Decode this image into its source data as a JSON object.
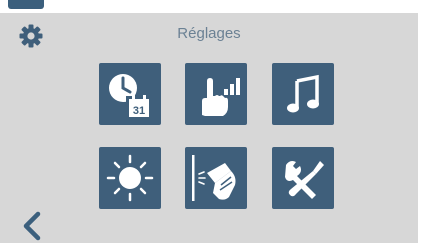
{
  "header": {
    "title": "Réglages",
    "settings_icon": "gear-icon"
  },
  "tiles": [
    {
      "name": "date-time-tile",
      "icon": "clock-calendar-icon",
      "calendar_day": "31"
    },
    {
      "name": "touch-sensitivity-tile",
      "icon": "hand-touch-signal-icon"
    },
    {
      "name": "sound-tile",
      "icon": "music-note-icon"
    },
    {
      "name": "brightness-tile",
      "icon": "sun-icon"
    },
    {
      "name": "cleaning-tile",
      "icon": "wipe-screen-icon"
    },
    {
      "name": "service-tools-tile",
      "icon": "wrench-screwdriver-icon"
    }
  ],
  "footer": {
    "back_icon": "chevron-left-icon"
  },
  "colors": {
    "background": "#d7d7d7",
    "tile": "#3f5f7b",
    "title": "#6b8194",
    "accent": "#3b5f7d"
  }
}
